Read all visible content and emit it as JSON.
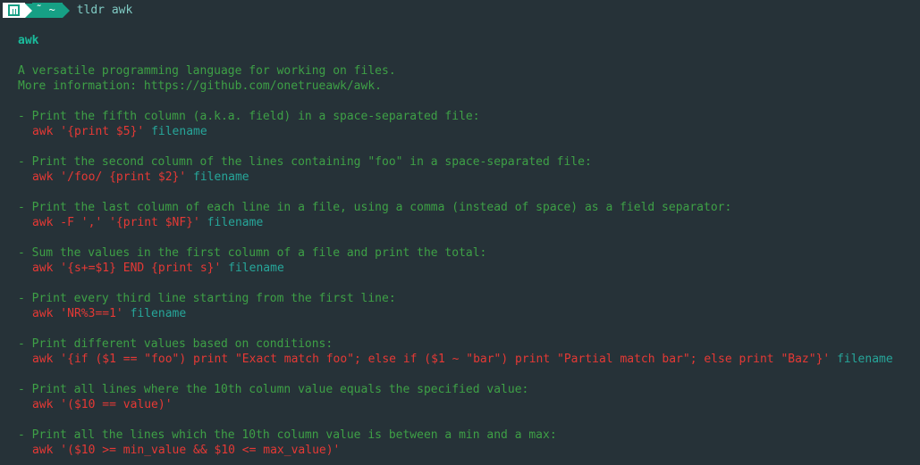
{
  "prompt": {
    "logo_icon": "manjaro-logo-icon",
    "path_symbols": "˜ ~",
    "command": "tldr awk"
  },
  "page": {
    "title": "awk",
    "description": "A versatile programming language for working on files.",
    "more_info": "More information: https://github.com/onetrueawk/awk."
  },
  "examples": [
    {
      "desc": "- Print the fifth column (a.k.a. field) in a space-separated file:",
      "code": "awk '{print $5}'",
      "arg": "filename"
    },
    {
      "desc": "- Print the second column of the lines containing \"foo\" in a space-separated file:",
      "code": "awk '/foo/ {print $2}'",
      "arg": "filename"
    },
    {
      "desc": "- Print the last column of each line in a file, using a comma (instead of space) as a field separator:",
      "code": "awk -F ',' '{print $NF}'",
      "arg": "filename"
    },
    {
      "desc": "- Sum the values in the first column of a file and print the total:",
      "code": "awk '{s+=$1} END {print s}'",
      "arg": "filename"
    },
    {
      "desc": "- Print every third line starting from the first line:",
      "code": "awk 'NR%3==1'",
      "arg": "filename"
    },
    {
      "desc": "- Print different values based on conditions:",
      "code": "awk '{if ($1 == \"foo\") print \"Exact match foo\"; else if ($1 ~ \"bar\") print \"Partial match bar\"; else print \"Baz\"}'",
      "arg": "filename"
    },
    {
      "desc": "- Print all lines where the 10th column value equals the specified value:",
      "code": "awk '($10 == value)'",
      "arg": ""
    },
    {
      "desc": "- Print all the lines which the 10th column value is between a min and a max:",
      "code": "awk '($10 >= min_value && $10 <= max_value)'",
      "arg": ""
    }
  ],
  "colors": {
    "background": "#263238",
    "description": "#3ea046",
    "code": "#e53935",
    "argument": "#26a69a",
    "title": "#1abc9c",
    "prompt_accent": "#16a085"
  }
}
